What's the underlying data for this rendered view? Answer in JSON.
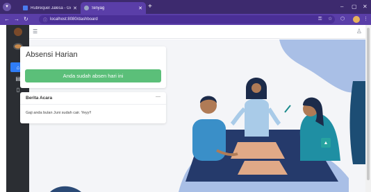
{
  "browser": {
    "tabs": [
      {
        "label": "Rubrequel Jalesa - Google Doc",
        "active": false,
        "favicon_color": "#4a7cf0"
      },
      {
        "label": "Sinyag",
        "active": true,
        "favicon_color": "#9aa6c2"
      }
    ],
    "address": {
      "url": "localhost:8080/dashboard"
    },
    "colors": {
      "tabbar": "#3d2a6e",
      "toolbar": "#5a3ea8"
    }
  },
  "sidebar": {
    "items": [
      {
        "icon": "home-icon",
        "active": true
      },
      {
        "icon": "clipboard-icon",
        "active": false
      },
      {
        "icon": "document-icon",
        "active": false
      }
    ]
  },
  "absensi": {
    "title": "Absensi Harian",
    "status_label": "Anda sudah absen hari ini"
  },
  "berita": {
    "title": "Berita Acara",
    "message": "Gaji anda bulan Juni sudah cair. Yeyy!!"
  },
  "colors": {
    "accent": "#2f7df6",
    "success": "#5bbf79",
    "teal": "#27a3a0",
    "shape": "#a9bfe6",
    "navy": "#253a6b"
  }
}
